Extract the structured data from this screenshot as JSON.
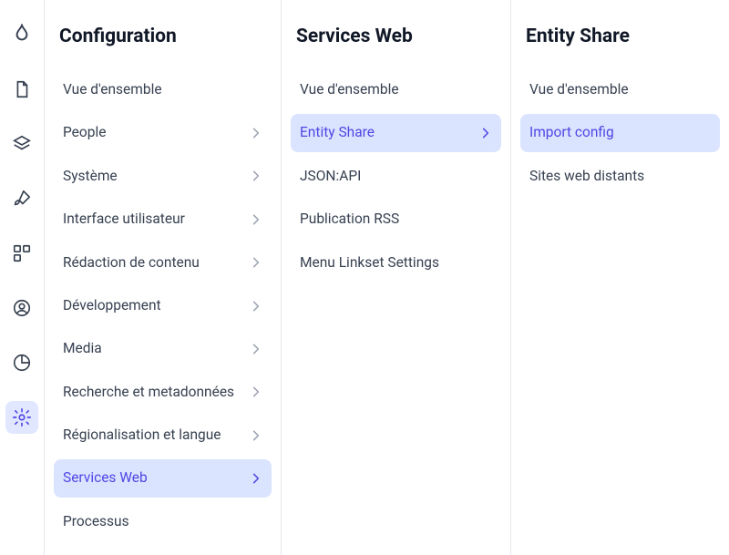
{
  "iconbar": {
    "items": [
      {
        "name": "drupal-icon",
        "active": false
      },
      {
        "name": "document-icon",
        "active": false
      },
      {
        "name": "layers-icon",
        "active": false
      },
      {
        "name": "paintbrush-icon",
        "active": false
      },
      {
        "name": "blocks-icon",
        "active": false
      },
      {
        "name": "user-circle-icon",
        "active": false
      },
      {
        "name": "chart-pie-icon",
        "active": false
      },
      {
        "name": "settings-gear-icon",
        "active": true
      }
    ]
  },
  "columns": [
    {
      "title": "Configuration",
      "items": [
        {
          "label": "Vue d'ensemble",
          "has_children": false,
          "active": false
        },
        {
          "label": "People",
          "has_children": true,
          "active": false
        },
        {
          "label": "Système",
          "has_children": true,
          "active": false
        },
        {
          "label": "Interface utilisateur",
          "has_children": true,
          "active": false
        },
        {
          "label": "Rédaction de contenu",
          "has_children": true,
          "active": false
        },
        {
          "label": "Développement",
          "has_children": true,
          "active": false
        },
        {
          "label": "Media",
          "has_children": true,
          "active": false
        },
        {
          "label": "Recherche et metadonnées",
          "has_children": true,
          "active": false
        },
        {
          "label": "Régionalisation et langue",
          "has_children": true,
          "active": false
        },
        {
          "label": "Services Web",
          "has_children": true,
          "active": true
        },
        {
          "label": "Processus",
          "has_children": false,
          "active": false
        }
      ]
    },
    {
      "title": "Services Web",
      "items": [
        {
          "label": "Vue d'ensemble",
          "has_children": false,
          "active": false
        },
        {
          "label": "Entity Share",
          "has_children": true,
          "active": true
        },
        {
          "label": "JSON:API",
          "has_children": false,
          "active": false
        },
        {
          "label": "Publication RSS",
          "has_children": false,
          "active": false
        },
        {
          "label": "Menu Linkset Settings",
          "has_children": false,
          "active": false
        }
      ]
    },
    {
      "title": "Entity Share",
      "items": [
        {
          "label": "Vue d'ensemble",
          "has_children": false,
          "active": false
        },
        {
          "label": "Import config",
          "has_children": false,
          "active": true
        },
        {
          "label": "Sites web distants",
          "has_children": false,
          "active": false
        }
      ]
    }
  ]
}
